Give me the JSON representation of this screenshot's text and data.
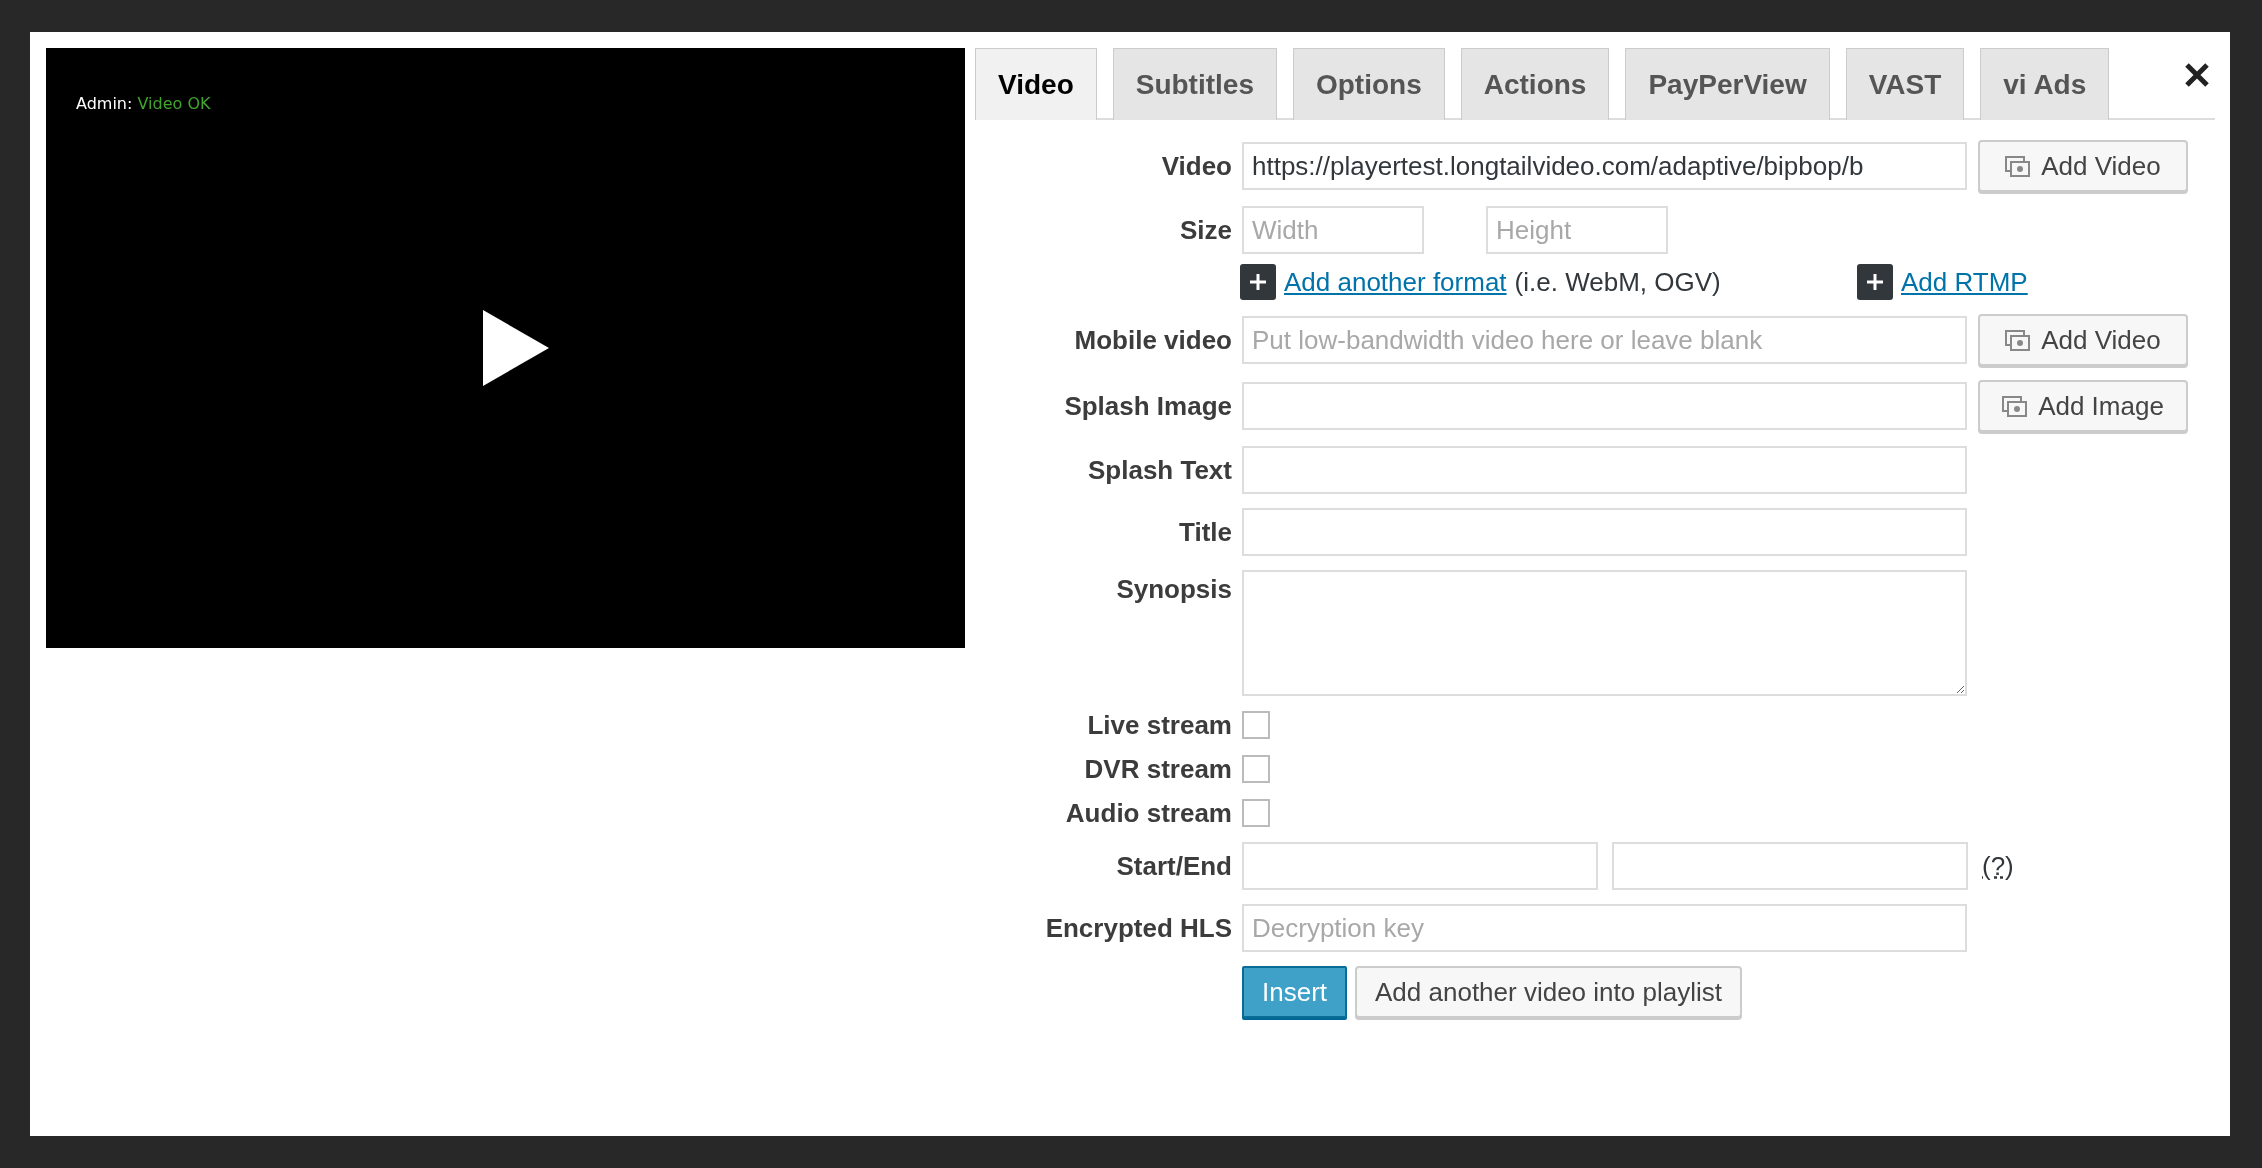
{
  "player": {
    "admin_label": "Admin:",
    "status": "Video OK"
  },
  "tabs": [
    {
      "label": "Video",
      "selected": true
    },
    {
      "label": "Subtitles",
      "selected": false
    },
    {
      "label": "Options",
      "selected": false
    },
    {
      "label": "Actions",
      "selected": false
    },
    {
      "label": "PayPerView",
      "selected": false
    },
    {
      "label": "VAST",
      "selected": false
    },
    {
      "label": "vi Ads",
      "selected": false
    }
  ],
  "rows": [
    {
      "kind": "text",
      "label": "Video",
      "value": "https://playertest.longtailvideo.com/adaptive/bipbop/b",
      "button": "Add Video"
    },
    {
      "kind": "size",
      "label": "Size",
      "inputs": [
        {
          "placeholder": "Width"
        },
        {
          "placeholder": "Height"
        }
      ]
    },
    {
      "kind": "links",
      "links": [
        {
          "text": "Add another format",
          "note": "(i.e. WebM, OGV)"
        },
        {
          "text": "Add RTMP"
        }
      ]
    },
    {
      "kind": "text",
      "label": "Mobile video",
      "placeholder": "Put low-bandwidth video here or leave blank",
      "button": "Add Video"
    },
    {
      "kind": "text",
      "label": "Splash Image",
      "button": "Add Image"
    },
    {
      "kind": "text",
      "label": "Splash Text"
    },
    {
      "kind": "text",
      "label": "Title"
    },
    {
      "kind": "textarea",
      "label": "Synopsis"
    },
    {
      "kind": "checkbox",
      "label": "Live stream",
      "checked": false
    },
    {
      "kind": "checkbox",
      "label": "DVR stream",
      "checked": false
    },
    {
      "kind": "checkbox",
      "label": "Audio stream",
      "checked": false
    },
    {
      "kind": "pair",
      "label": "Start/End",
      "help": "(?)"
    },
    {
      "kind": "text",
      "label": "Encrypted HLS",
      "placeholder": "Decryption key"
    },
    {
      "kind": "actions",
      "buttons": [
        {
          "label": "Insert",
          "primary": true
        },
        {
          "label": "Add another video into playlist",
          "primary": false
        }
      ]
    }
  ]
}
